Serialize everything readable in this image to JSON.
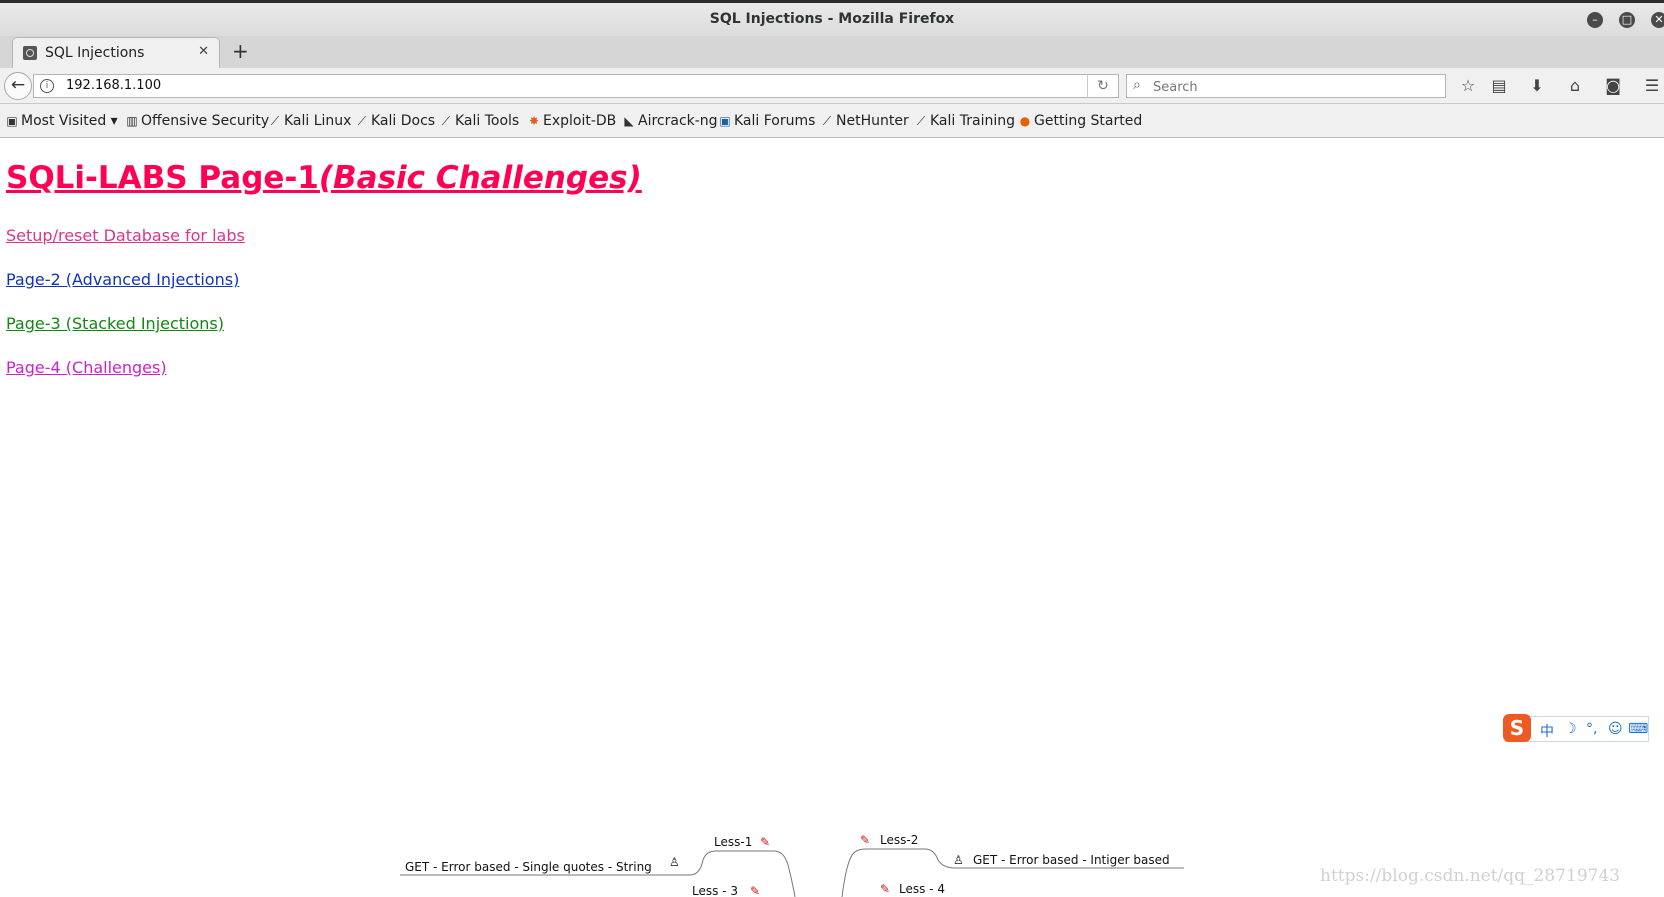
{
  "window": {
    "title": "SQL Injections - Mozilla Firefox"
  },
  "tab": {
    "label": "SQL Injections",
    "close": "✕",
    "new_tab": "+"
  },
  "nav": {
    "url": "192.168.1.100",
    "search_placeholder": "Search"
  },
  "bookmarks": [
    {
      "label": "Most Visited",
      "icon": "folder-icon"
    },
    {
      "label": "Offensive Security",
      "icon": "offsec-icon"
    },
    {
      "label": "Kali Linux",
      "icon": "kali-dragon-icon"
    },
    {
      "label": "Kali Docs",
      "icon": "kali-dragon-icon"
    },
    {
      "label": "Kali Tools",
      "icon": "kali-dragon-icon"
    },
    {
      "label": "Exploit-DB",
      "icon": "exploitdb-icon"
    },
    {
      "label": "Aircrack-ng",
      "icon": "aircrack-icon"
    },
    {
      "label": "Kali Forums",
      "icon": "forums-icon"
    },
    {
      "label": "NetHunter",
      "icon": "kali-dragon-icon"
    },
    {
      "label": "Kali Training",
      "icon": "kali-dragon-icon"
    },
    {
      "label": "Getting Started",
      "icon": "firefox-icon"
    }
  ],
  "page": {
    "title_main": "SQLi-LABS Page-1",
    "title_italic": "(Basic Challenges)",
    "links": [
      {
        "label": "Setup/reset Database for labs",
        "color": "#dd3388"
      },
      {
        "label": "Page-2 (Advanced Injections)",
        "color": "#1133bb"
      },
      {
        "label": "Page-3 (Stacked Injections)",
        "color": "#118811"
      },
      {
        "label": "Page-4 (Challenges)",
        "color": "#cc22cc"
      }
    ],
    "title_color": "#ff0055"
  },
  "ime": {
    "logo": "S",
    "items": [
      "中",
      "☽",
      "°,",
      "☺",
      "⌨"
    ]
  },
  "diagram": {
    "left_branch": "GET - Error based - Single quotes - String",
    "right_branch": "GET - Error based - Intiger based",
    "nodes": [
      "Less-1",
      "Less - 3",
      "Less-2",
      "Less - 4"
    ]
  },
  "watermark": "https://blog.csdn.net/qq_28719743"
}
